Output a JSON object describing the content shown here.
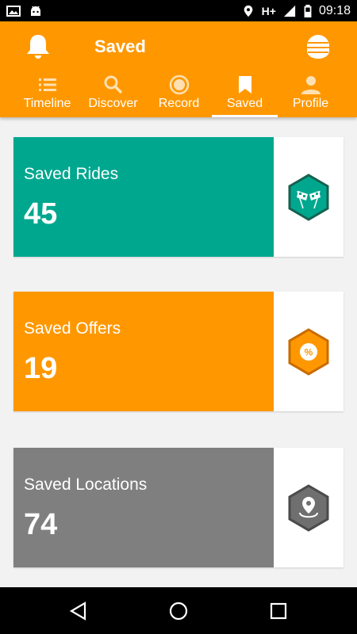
{
  "status_bar": {
    "network": "H+",
    "time": "09:18"
  },
  "header": {
    "title": "Saved"
  },
  "tabs": [
    {
      "label": "Timeline",
      "icon": "list-icon"
    },
    {
      "label": "Discover",
      "icon": "search-icon"
    },
    {
      "label": "Record",
      "icon": "record-icon"
    },
    {
      "label": "Saved",
      "icon": "bookmark-icon"
    },
    {
      "label": "Profile",
      "icon": "person-icon"
    }
  ],
  "cards": [
    {
      "label": "Saved Rides",
      "count": "45",
      "color": "#00a78f",
      "icon": "checkered-flags-icon"
    },
    {
      "label": "Saved Offers",
      "count": "19",
      "color": "#ff9800",
      "icon": "percent-badge-icon"
    },
    {
      "label": "Saved Locations",
      "count": "74",
      "color": "#7f7f7f",
      "icon": "location-pin-icon"
    }
  ],
  "colors": {
    "accent": "#ff9800",
    "teal": "#00a78f",
    "grey": "#7f7f7f"
  }
}
